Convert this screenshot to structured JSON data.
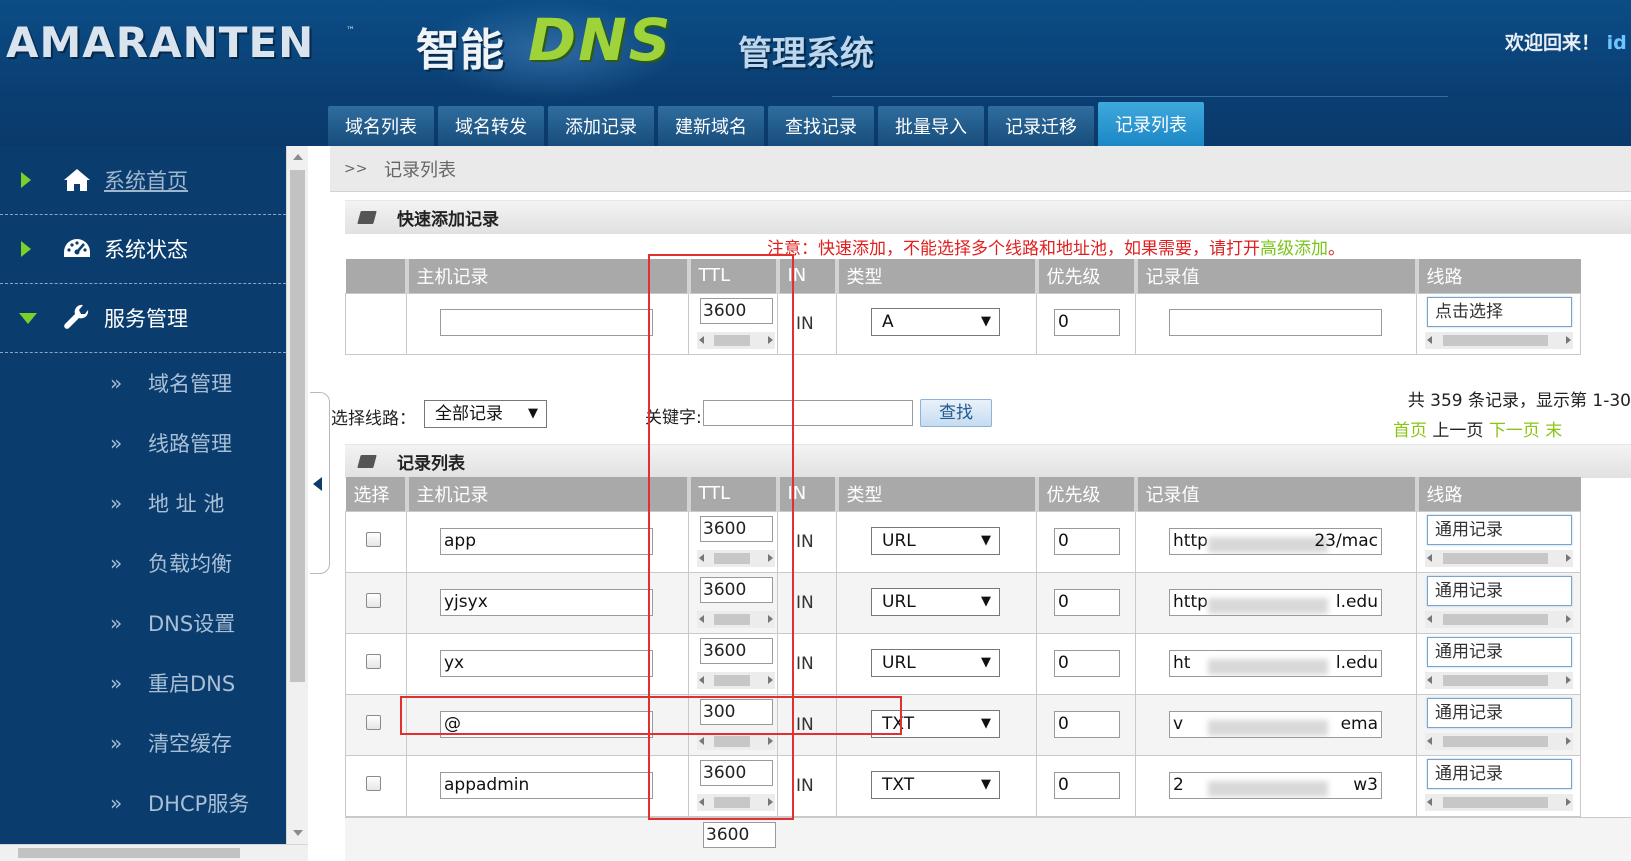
{
  "header": {
    "logo": "AMARANTEN",
    "trademark": "™",
    "title_cn1": "智能",
    "title_dns": "DNS",
    "title_cn2": "管理系统",
    "welcome": "欢迎回来！",
    "user": "id"
  },
  "tabs": [
    {
      "label": "域名列表",
      "active": false
    },
    {
      "label": "域名转发",
      "active": false
    },
    {
      "label": "添加记录",
      "active": false
    },
    {
      "label": "建新域名",
      "active": false
    },
    {
      "label": "查找记录",
      "active": false
    },
    {
      "label": "批量导入",
      "active": false
    },
    {
      "label": "记录迁移",
      "active": false
    },
    {
      "label": "记录列表",
      "active": true
    }
  ],
  "sidebar": {
    "main": [
      {
        "label": "系统首页",
        "icon": "home-icon"
      },
      {
        "label": "系统状态",
        "icon": "dashboard-icon"
      },
      {
        "label": "服务管理",
        "icon": "wrench-icon"
      }
    ],
    "sub": [
      "域名管理",
      "线路管理",
      "地 址 池",
      "负载均衡",
      "DNS设置",
      "重启DNS",
      "清空缓存",
      "DHCP服务"
    ]
  },
  "breadcrumb": {
    "sep": ">>",
    "current": "记录列表"
  },
  "quick_add": {
    "title": "快速添加记录",
    "notice_prefix": "注意：快速添加，不能选择多个线路和地址池，如果需要，请打开",
    "notice_link": "高级添加",
    "notice_suffix": "。",
    "columns": [
      "",
      "主机记录",
      "TTL",
      "IN",
      "类型",
      "优先级",
      "记录值",
      "线路"
    ],
    "row": {
      "host": "",
      "ttl": "3600",
      "in": "IN",
      "type": "A",
      "priority": "0",
      "value": "",
      "route": "点击选择"
    }
  },
  "search": {
    "route_label": "选择线路：",
    "route_value": "全部记录",
    "keyword_label": "关键字:",
    "keyword_value": "",
    "button": "查找",
    "stat": "共 359 条记录，显示第 1-30",
    "pager_first": "首页",
    "pager_prev": "上一页",
    "pager_next": "下一页",
    "pager_last": "末"
  },
  "records": {
    "title": "记录列表",
    "columns": [
      "选择",
      "主机记录",
      "TTL",
      "IN",
      "类型",
      "优先级",
      "记录值",
      "线路"
    ],
    "rows": [
      {
        "host": "app",
        "ttl": "3600",
        "in": "IN",
        "type": "URL",
        "priority": "0",
        "value_start": "http",
        "value_end": "23/mac",
        "route": "通用记录"
      },
      {
        "host": "yjsyx",
        "ttl": "3600",
        "in": "IN",
        "type": "URL",
        "priority": "0",
        "value_start": "http",
        "value_end": "l.edu",
        "route": "通用记录"
      },
      {
        "host": "yx",
        "ttl": "3600",
        "in": "IN",
        "type": "URL",
        "priority": "0",
        "value_start": "ht",
        "value_end": "l.edu",
        "route": "通用记录"
      },
      {
        "host": "@",
        "ttl": "300",
        "in": "IN",
        "type": "TXT",
        "priority": "0",
        "value_start": "v",
        "value_end": "ema",
        "route": "通用记录"
      },
      {
        "host": "appadmin",
        "ttl": "3600",
        "in": "IN",
        "type": "TXT",
        "priority": "0",
        "value_start": "2",
        "value_end": "w3",
        "route": "通用记录"
      }
    ],
    "next_ttl_partial": "3600"
  },
  "colors": {
    "header_bg": "#0a3f73",
    "sidebar_bg": "#0a3d6e",
    "accent_green": "#7ad12a",
    "dns_green": "#9ed43a",
    "active_tab": "#1b87c5",
    "notice_red": "#e02020",
    "highlight_red": "#e0312f"
  }
}
